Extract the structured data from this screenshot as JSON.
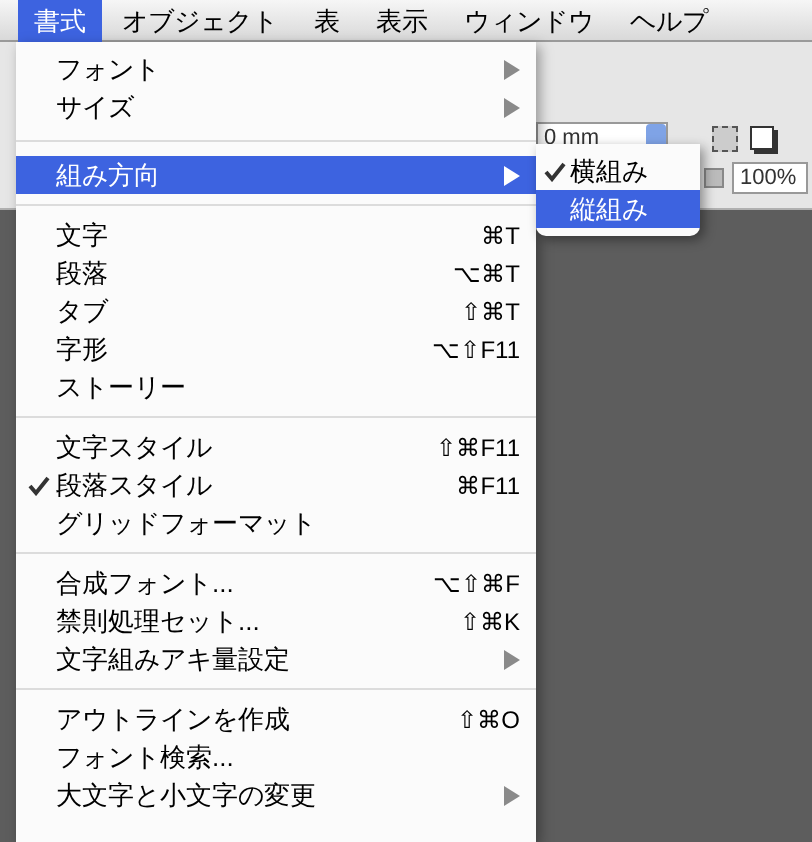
{
  "menubar": [
    {
      "label": "書式",
      "selected": true
    },
    {
      "label": "オブジェクト",
      "selected": false
    },
    {
      "label": "表",
      "selected": false
    },
    {
      "label": "表示",
      "selected": false
    },
    {
      "label": "ウィンドウ",
      "selected": false
    },
    {
      "label": "ヘルプ",
      "selected": false
    }
  ],
  "toolbar": {
    "offset_field": "0 mm",
    "zoom_field": "100%"
  },
  "menu": {
    "sections": [
      [
        {
          "label": "フォント",
          "submenu": true,
          "checked": false,
          "selected": false
        },
        {
          "label": "サイズ",
          "submenu": true,
          "checked": false,
          "selected": false
        }
      ],
      [
        {
          "label": "組み方向",
          "submenu": true,
          "checked": false,
          "selected": true
        }
      ],
      [
        {
          "label": "文字",
          "shortcut": "⌘T",
          "submenu": false,
          "checked": false,
          "selected": false
        },
        {
          "label": "段落",
          "shortcut": "⌥⌘T",
          "submenu": false,
          "checked": false,
          "selected": false
        },
        {
          "label": "タブ",
          "shortcut": "⇧⌘T",
          "submenu": false,
          "checked": false,
          "selected": false
        },
        {
          "label": "字形",
          "shortcut": "⌥⇧F11",
          "submenu": false,
          "checked": false,
          "selected": false
        },
        {
          "label": "ストーリー",
          "submenu": false,
          "checked": false,
          "selected": false
        }
      ],
      [
        {
          "label": "文字スタイル",
          "shortcut": "⇧⌘F11",
          "submenu": false,
          "checked": false,
          "selected": false
        },
        {
          "label": "段落スタイル",
          "shortcut": "⌘F11",
          "submenu": false,
          "checked": true,
          "selected": false
        },
        {
          "label": "グリッドフォーマット",
          "submenu": false,
          "checked": false,
          "selected": false
        }
      ],
      [
        {
          "label": "合成フォント...",
          "shortcut": "⌥⇧⌘F",
          "submenu": false,
          "checked": false,
          "selected": false
        },
        {
          "label": "禁則処理セット...",
          "shortcut": "⇧⌘K",
          "submenu": false,
          "checked": false,
          "selected": false
        },
        {
          "label": "文字組みアキ量設定",
          "submenu": true,
          "checked": false,
          "selected": false
        }
      ],
      [
        {
          "label": "アウトラインを作成",
          "shortcut": "⇧⌘O",
          "submenu": false,
          "checked": false,
          "selected": false
        },
        {
          "label": "フォント検索...",
          "submenu": false,
          "checked": false,
          "selected": false
        },
        {
          "label": "大文字と小文字の変更",
          "submenu": true,
          "checked": false,
          "selected": false
        }
      ]
    ]
  },
  "submenu": {
    "items": [
      {
        "label": "横組み",
        "checked": true,
        "selected": false
      },
      {
        "label": "縦組み",
        "checked": false,
        "selected": true
      }
    ]
  }
}
